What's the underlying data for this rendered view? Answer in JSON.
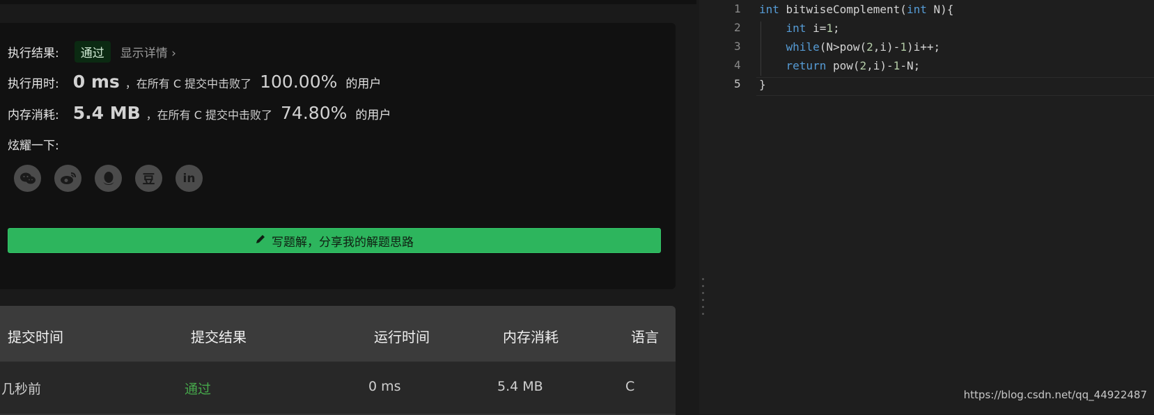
{
  "result": {
    "label": "执行结果:",
    "status": "通过",
    "detail": "显示详情 ›"
  },
  "time": {
    "label": "执行用时:",
    "value": "0 ms",
    "text": "，在所有 C 提交中击败了",
    "percent": "100.00%",
    "users": "的用户"
  },
  "memory": {
    "label": "内存消耗:",
    "value": "5.4 MB",
    "text": "，在所有 C 提交中击败了",
    "percent": "74.80%",
    "users": "的用户"
  },
  "share": {
    "label": "炫耀一下:",
    "icons": [
      "wechat-icon",
      "weibo-icon",
      "qq-icon",
      "douban-icon",
      "linkedin-icon"
    ],
    "douban_glyph": "豆",
    "linkedin_glyph": "in"
  },
  "write_button": {
    "label": "写题解，分享我的解题思路"
  },
  "submissions": {
    "headers": [
      "提交时间",
      "提交结果",
      "运行时间",
      "内存消耗",
      "语言"
    ],
    "rows": [
      {
        "time": "几秒前",
        "result": "通过",
        "runtime": "0 ms",
        "memory": "5.4 MB",
        "language": "C"
      }
    ]
  },
  "editor": {
    "line_numbers": [
      "1",
      "2",
      "3",
      "4",
      "5"
    ],
    "lines": [
      "int bitwiseComplement(int N){",
      "    int i=1;",
      "    while(N>pow(2,i)-1)i++;",
      "    return pow(2,i)-1-N;",
      "}"
    ]
  },
  "watermark": "https://blog.csdn.net/qq_44922487",
  "colors": {
    "accent_green": "#2db55d",
    "pass_green": "#46a84b",
    "keyword_blue": "#569cd6"
  }
}
